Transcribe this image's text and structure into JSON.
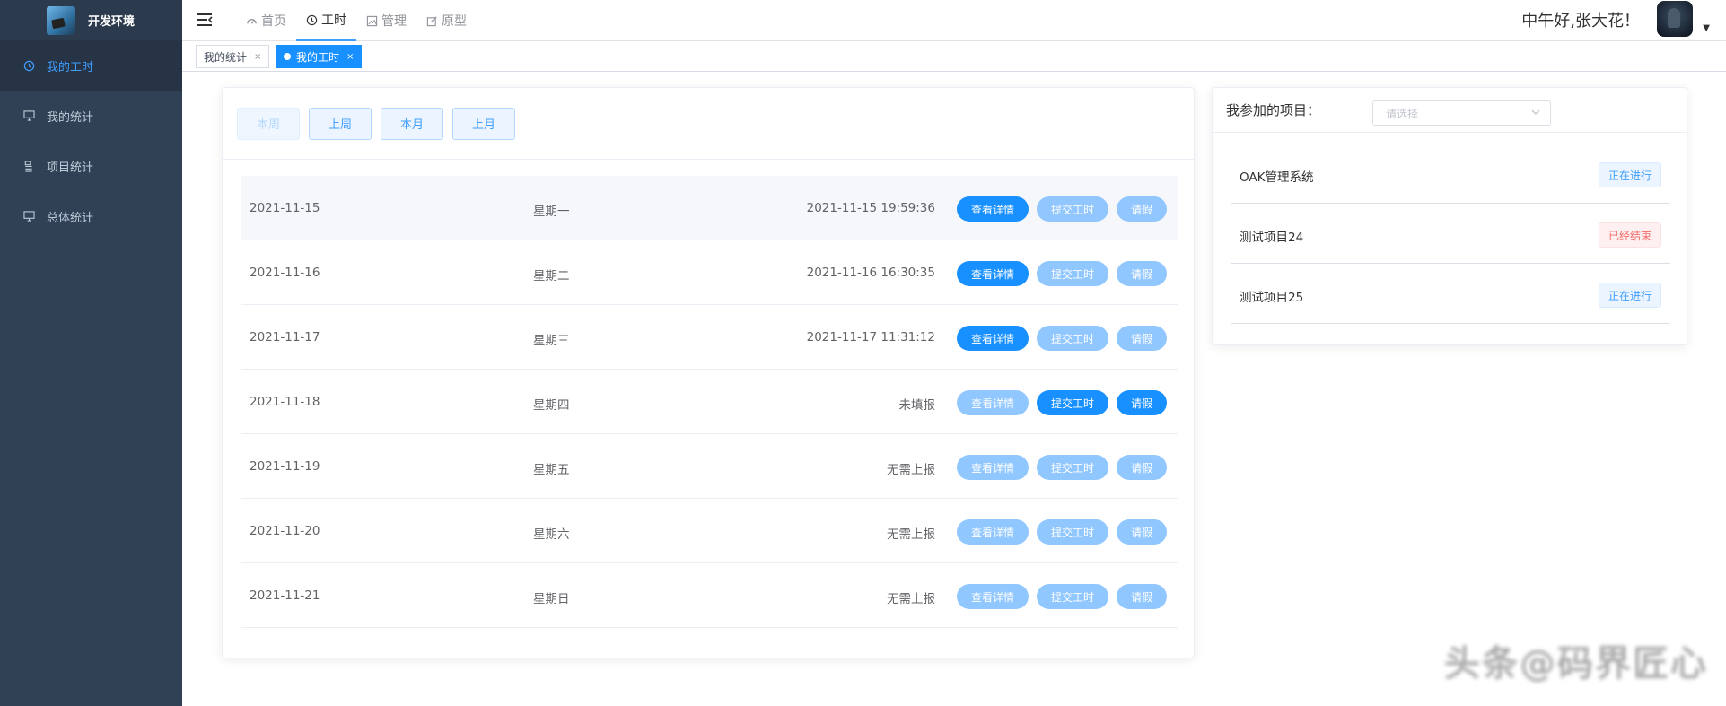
{
  "sidebar": {
    "title": "开发环境",
    "items": [
      {
        "label": "我的工时",
        "icon": "clock-icon",
        "active": true
      },
      {
        "label": "我的统计",
        "icon": "monitor-icon",
        "active": false
      },
      {
        "label": "项目统计",
        "icon": "list-icon",
        "active": false
      },
      {
        "label": "总体统计",
        "icon": "monitor-icon",
        "active": false
      }
    ]
  },
  "header": {
    "nav": [
      {
        "label": "首页",
        "icon": "dashboard-icon"
      },
      {
        "label": "工时",
        "icon": "clock-icon",
        "active": true
      },
      {
        "label": "管理",
        "icon": "image-icon"
      },
      {
        "label": "原型",
        "icon": "edit-icon"
      }
    ],
    "greeting": "中午好,张大花！"
  },
  "tags": [
    {
      "label": "我的统计",
      "active": false
    },
    {
      "label": "我的工时",
      "active": true
    }
  ],
  "periods": [
    "本周",
    "上周",
    "本月",
    "上月"
  ],
  "actions": {
    "view": "查看详情",
    "submit": "提交工时",
    "leave": "请假"
  },
  "rows": [
    {
      "date": "2021-11-15",
      "weekday": "星期一",
      "status": "2021-11-15 19:59:36"
    },
    {
      "date": "2021-11-16",
      "weekday": "星期二",
      "status": "2021-11-16 16:30:35"
    },
    {
      "date": "2021-11-17",
      "weekday": "星期三",
      "status": "2021-11-17 11:31:12"
    },
    {
      "date": "2021-11-18",
      "weekday": "星期四",
      "status": "未填报"
    },
    {
      "date": "2021-11-19",
      "weekday": "星期五",
      "status": "无需上报"
    },
    {
      "date": "2021-11-20",
      "weekday": "星期六",
      "status": "无需上报"
    },
    {
      "date": "2021-11-21",
      "weekday": "星期日",
      "status": "无需上报"
    }
  ],
  "projects": {
    "label": "我参加的项目：",
    "select_placeholder": "请选择",
    "items": [
      {
        "name": "OAK管理系统",
        "status": "正在进行",
        "state": "running"
      },
      {
        "name": "测试项目24",
        "status": "已经结束",
        "state": "ended"
      },
      {
        "name": "测试项目25",
        "status": "正在进行",
        "state": "running"
      }
    ]
  },
  "watermark": "头条@码界匠心",
  "colors": {
    "primary": "#1890ff",
    "sidebar_bg": "#304156",
    "danger": "#f56c6c"
  }
}
